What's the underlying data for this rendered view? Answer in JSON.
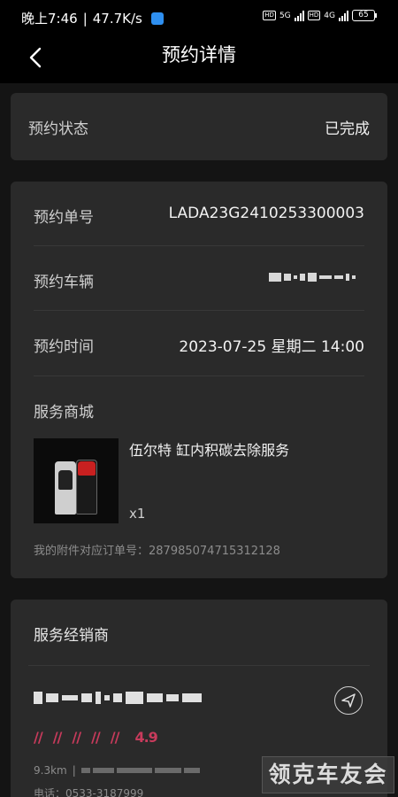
{
  "status_bar": {
    "time": "晚上7:46",
    "net_speed": "47.7K/s",
    "net_tag": "5G",
    "net_tag2": "4G",
    "battery": "65"
  },
  "nav": {
    "title": "预约详情"
  },
  "status_card": {
    "label": "预约状态",
    "value": "已完成"
  },
  "details": {
    "order_no_label": "预约单号",
    "order_no": "LADA23G2410253300003",
    "vehicle_label": "预约车辆",
    "time_label": "预约时间",
    "time_value": "2023-07-25 星期二 14:00",
    "mall_label": "服务商城",
    "product_name": "伍尔特 缸内积碳去除服务",
    "product_qty": "x1",
    "order_ref_line": "我的附件对应订单号：287985074715312128"
  },
  "dealer": {
    "label": "服务经销商",
    "rating": "4.9",
    "distance": "9.3km",
    "phone": "电话：0533-3187999"
  },
  "watermark": {
    "text": "领克车友会"
  },
  "colors": {
    "tag": "#c83b5c",
    "card": "#2a2a2a",
    "bg": "#141414"
  }
}
